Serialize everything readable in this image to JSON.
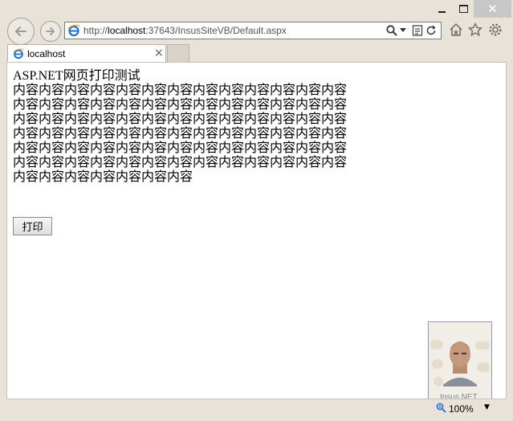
{
  "window": {
    "controls": {
      "minimize": "minimize",
      "maximize": "maximize",
      "close": "✕"
    }
  },
  "address_bar": {
    "prefix": "http://",
    "host": "localhost",
    "rest": ":37643/InsusSiteVB/Default.aspx"
  },
  "tab": {
    "title": "localhost",
    "close": "×"
  },
  "page": {
    "heading": "ASP.NET网页打印测试",
    "lines": [
      "内容内容内容内容内容内容内容内容内容内容内容内容内容",
      "内容内容内容内容内容内容内容内容内容内容内容内容内容",
      "内容内容内容内容内容内容内容内容内容内容内容内容内容",
      "内容内容内容内容内容内容内容内容内容内容内容内容内容",
      "内容内容内容内容内容内容内容内容内容内容内容内容内容",
      "内容内容内容内容内容内容内容内容内容内容内容内容内容",
      "内容内容内容内容内容内容内容"
    ],
    "print_button": "打印"
  },
  "watermark": {
    "label": "Insus.NET"
  },
  "status_bar": {
    "zoom": "100%"
  },
  "colors": {
    "window_bg": "#e9e2d8",
    "close_bg": "#c7c7c7",
    "ie_blue": "#1e6fd0"
  }
}
